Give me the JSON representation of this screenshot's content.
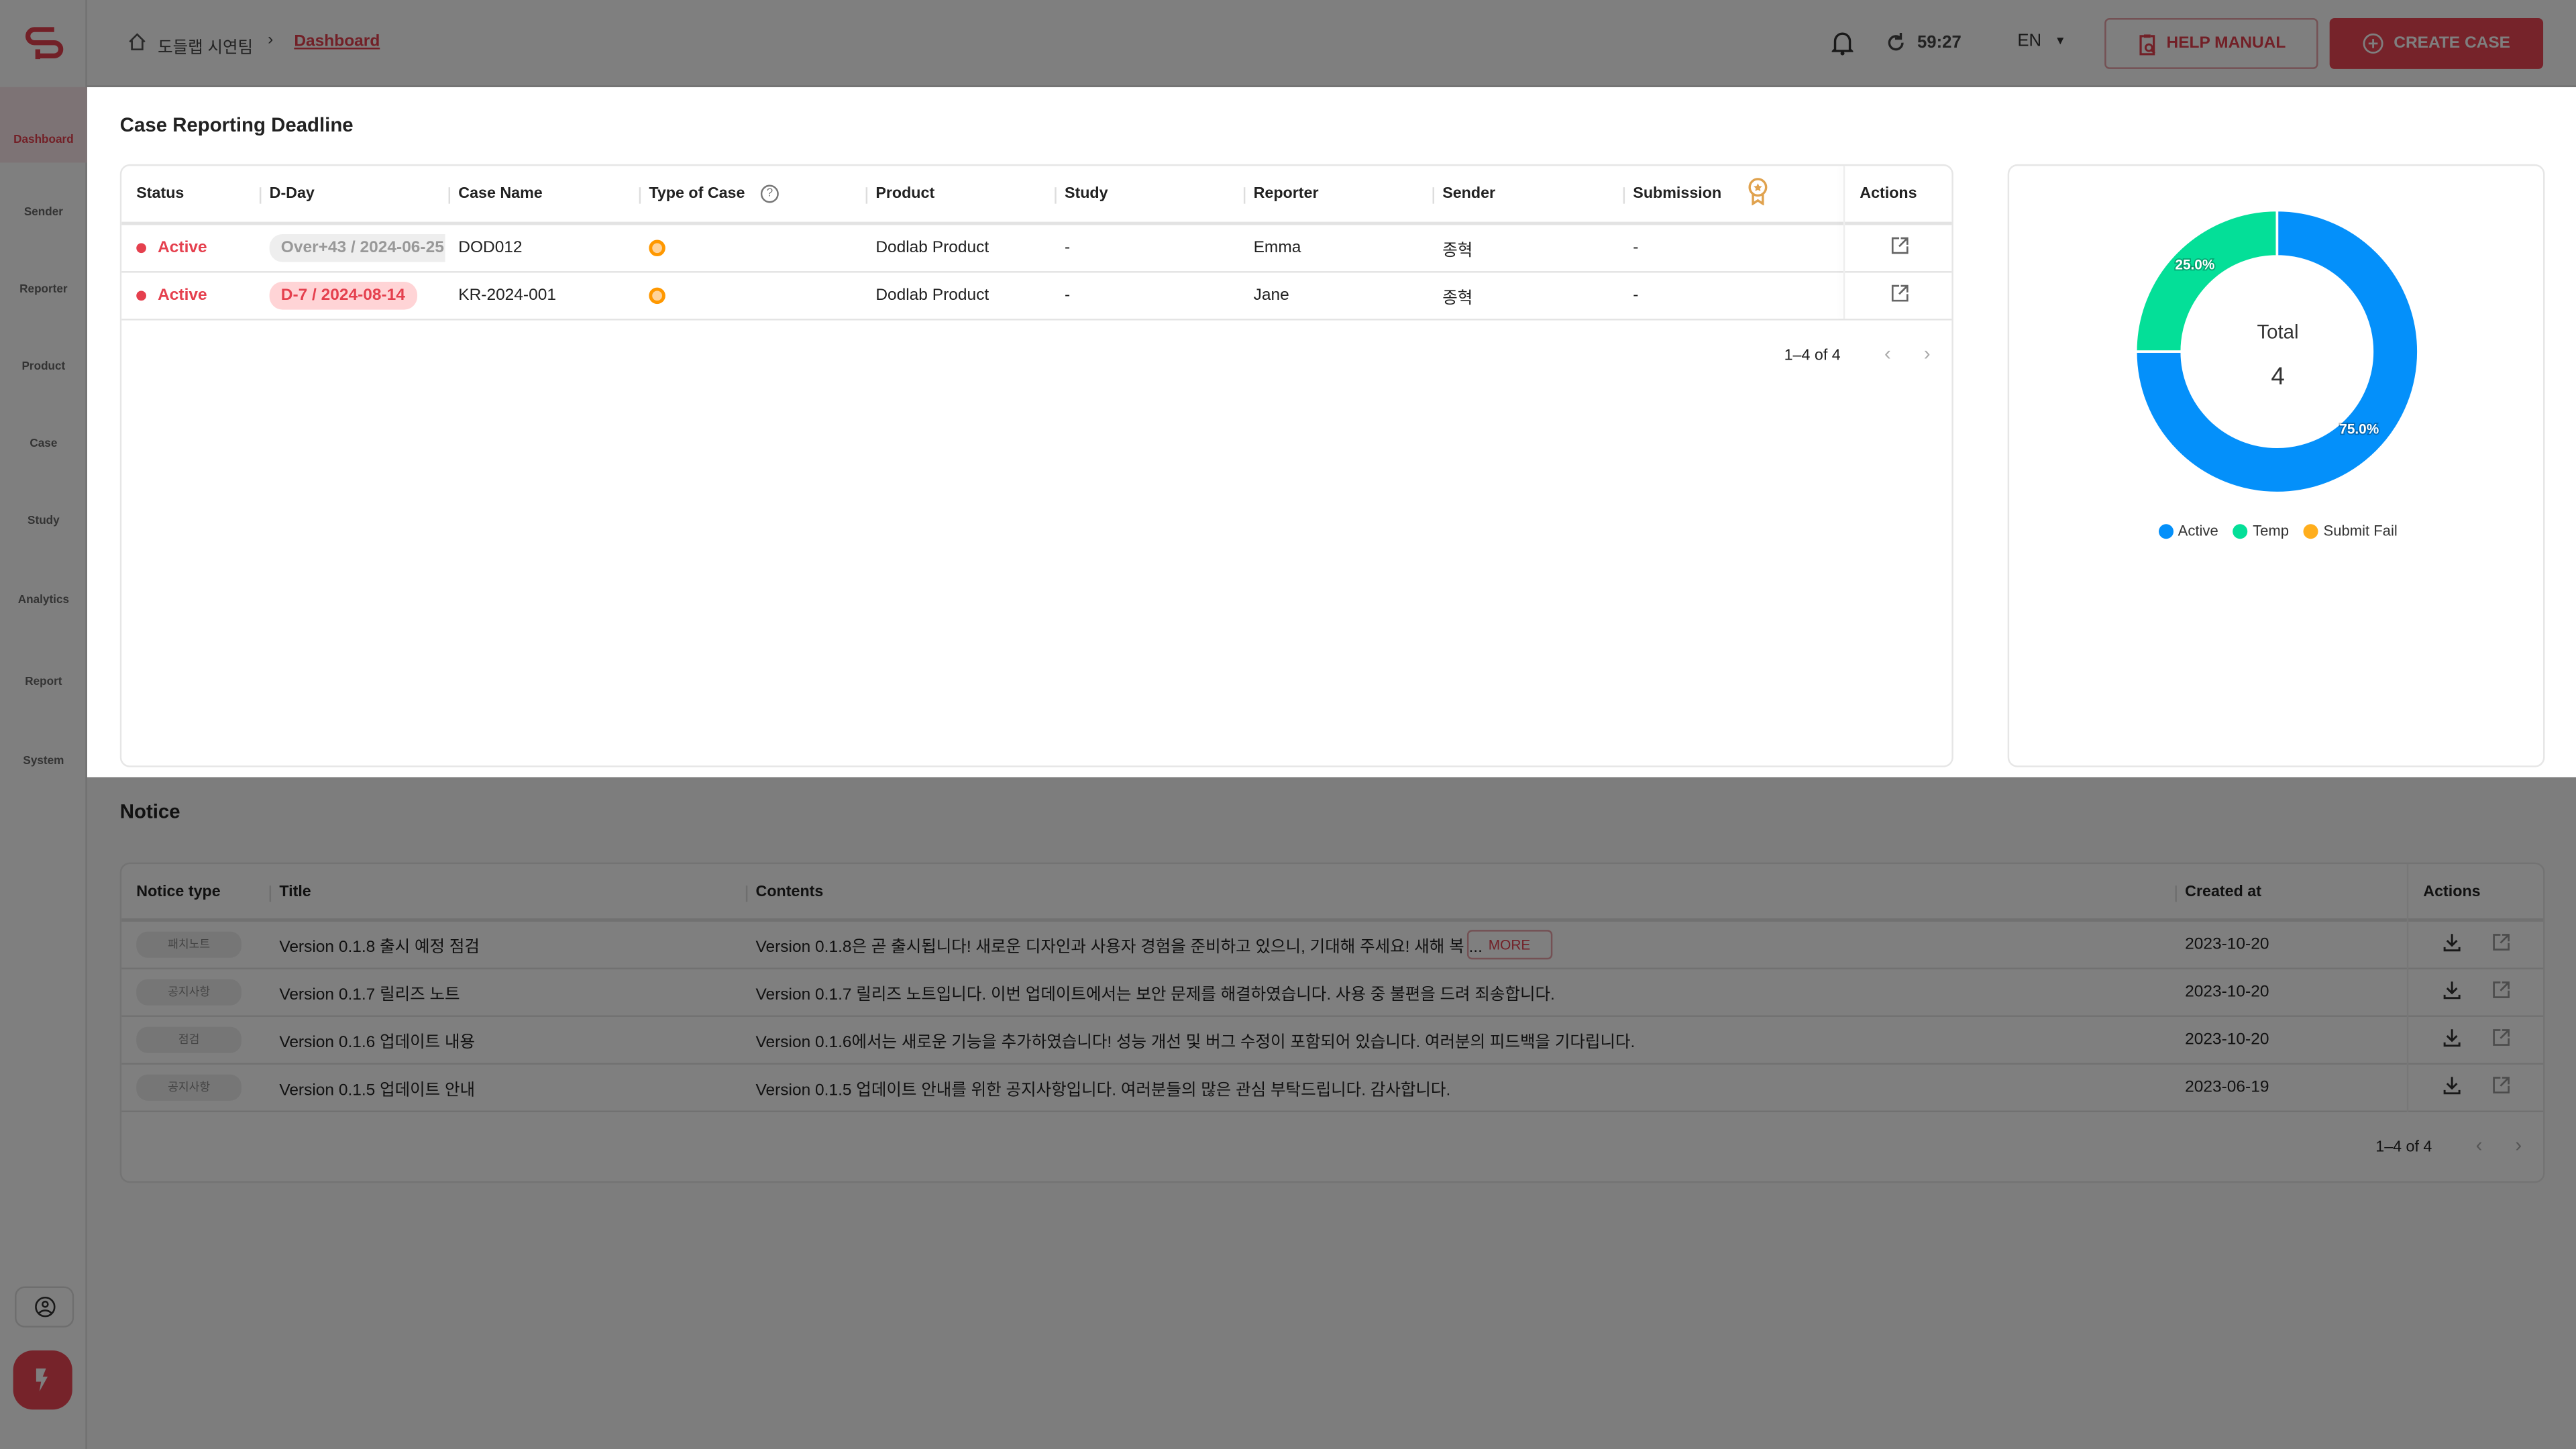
{
  "sidebar": {
    "items": [
      {
        "label": "Dashboard",
        "icon": "dashboard-icon",
        "active": true
      },
      {
        "label": "Sender",
        "icon": "sender-icon"
      },
      {
        "label": "Reporter",
        "icon": "flag-icon"
      },
      {
        "label": "Product",
        "icon": "product-icon"
      },
      {
        "label": "Case",
        "icon": "briefcase-icon"
      },
      {
        "label": "Study",
        "icon": "study-icon"
      },
      {
        "label": "Analytics",
        "icon": "analytics-icon"
      },
      {
        "label": "Report",
        "icon": "report-icon"
      },
      {
        "label": "System",
        "icon": "system-icon"
      }
    ]
  },
  "header": {
    "breadcrumb": [
      "도들랩 시연팀",
      "Dashboard"
    ],
    "timer": "59:27",
    "language": "EN",
    "help_manual": "HELP MANUAL",
    "create_case": "CREATE CASE"
  },
  "colors": {
    "accent": "#E5404E",
    "active": "#0490FA",
    "temp": "#04DF98",
    "submit_fail": "#FFAE1D"
  },
  "cases": {
    "title": "Case Reporting Deadline",
    "columns": [
      "Status",
      "D-Day",
      "Case Name",
      "Type of Case",
      "Product",
      "Study",
      "Reporter",
      "Sender",
      "Submission",
      "Actions"
    ],
    "rows": [
      {
        "status": "Active",
        "dday": "Over+43 / 2024-06-25",
        "case_name": "DOD012",
        "product": "Dodlab Product",
        "study": "-",
        "reporter": "Emma",
        "sender": "종혁",
        "submission": "-"
      },
      {
        "status": "Active",
        "dday": "D-7 / 2024-08-14",
        "case_name": "KR-2024-001",
        "product": "Dodlab Product",
        "study": "-",
        "reporter": "Jane",
        "sender": "종혁",
        "submission": "-"
      }
    ],
    "pagination": "1–4 of 4"
  },
  "chart_data": {
    "type": "pie",
    "donut": true,
    "categories": [
      "Active",
      "Temp",
      "Submit Fail"
    ],
    "values": [
      3,
      1,
      0
    ],
    "labels": [
      "75.0%",
      "25.0%",
      ""
    ],
    "center_label": "Total",
    "center_value": "4",
    "legend": "bottom",
    "colors": [
      "#0490FA",
      "#04DF98",
      "#FFAE1D"
    ]
  },
  "notice": {
    "title": "Notice",
    "columns": [
      "Notice type",
      "Title",
      "Contents",
      "Created at",
      "Actions"
    ],
    "rows": [
      {
        "type": "패치노트",
        "title": "Version 0.1.8 출시 예정 점검",
        "contents": "Version 0.1.8은 곧 출시됩니다! 새로운 디자인과 사용자 경험을 준비하고 있으니, 기대해 주세요! 새해 복 ...",
        "more": "MORE",
        "created": "2023-10-20"
      },
      {
        "type": "공지사항",
        "title": "Version 0.1.7 릴리즈 노트",
        "contents": "Version 0.1.7 릴리즈 노트입니다. 이번 업데이트에서는 보안 문제를 해결하였습니다. 사용 중 불편을 드려 죄송합니다.",
        "created": "2023-10-20"
      },
      {
        "type": "점검",
        "title": "Version 0.1.6 업데이트 내용",
        "contents": "Version 0.1.6에서는 새로운 기능을 추가하였습니다! 성능 개선 및 버그 수정이 포함되어 있습니다. 여러분의 피드백을 기다립니다.",
        "created": "2023-10-20"
      },
      {
        "type": "공지사항",
        "title": "Version 0.1.5 업데이트 안내",
        "contents": "Version 0.1.5 업데이트 안내를 위한 공지사항입니다. 여러분들의 많은 관심 부탁드립니다. 감사합니다.",
        "created": "2023-06-19"
      }
    ],
    "pagination": "1–4 of 4"
  }
}
